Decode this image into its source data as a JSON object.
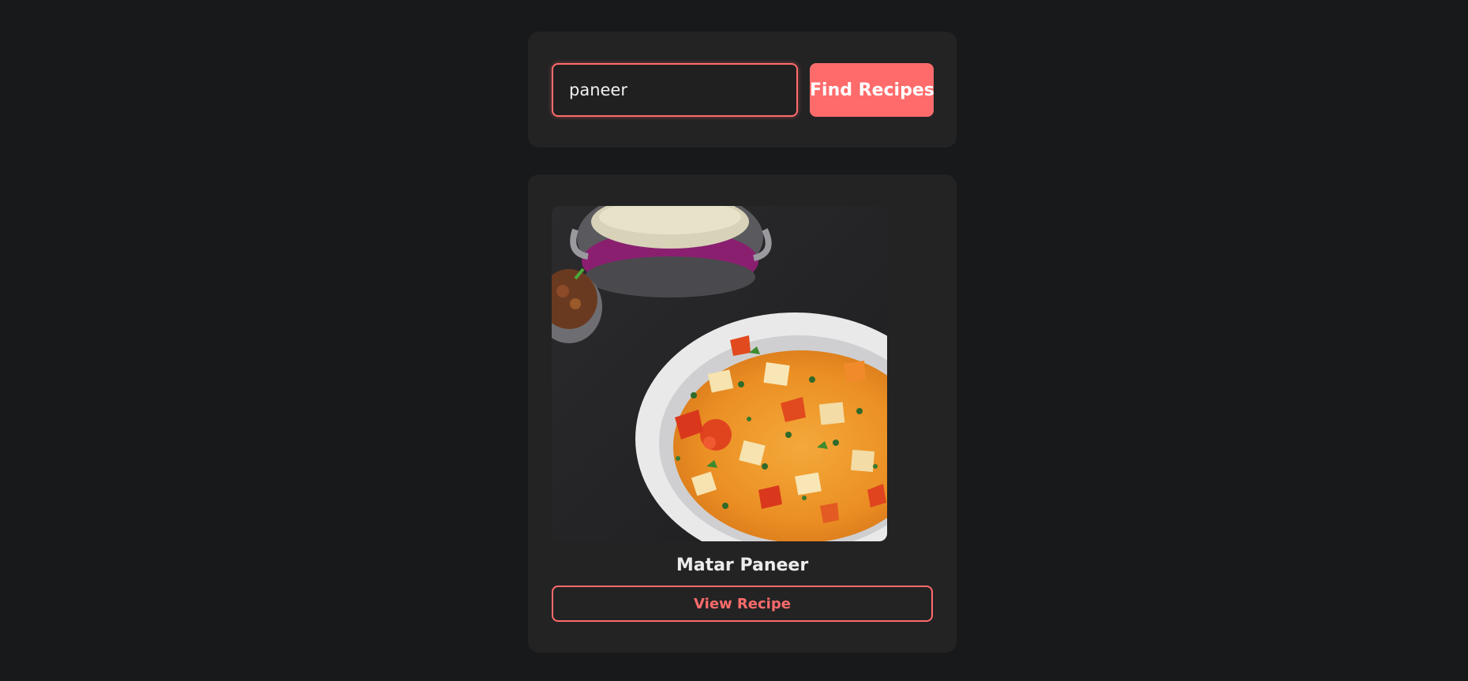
{
  "search": {
    "value": "paneer",
    "button_label": "Find Recipes"
  },
  "results": [
    {
      "title": "Matar Paneer",
      "image_alt": "Matar Paneer",
      "button_label": "View Recipe"
    }
  ],
  "colors": {
    "accent": "#ff6b6b",
    "background": "#18191b",
    "card": "#232324"
  }
}
